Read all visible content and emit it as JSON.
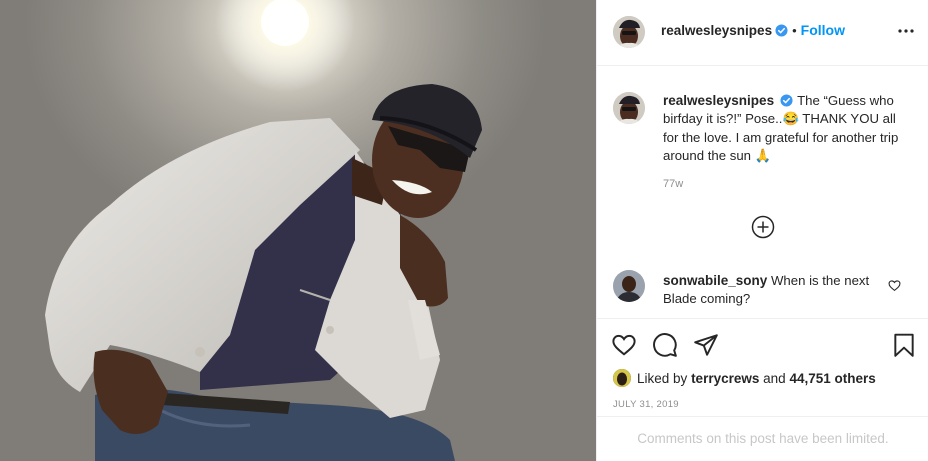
{
  "post": {
    "image_alt": "Photo of a man in a white blazer and flat cap smiling",
    "author": "realwesleysnipes",
    "follow_label": "Follow",
    "separator": "•",
    "caption": {
      "username": "realwesleysnipes",
      "text": "The “Guess who birfday it is?!” Pose..😂 THANK YOU all for the love. I am grateful for another trip around the sun 🙏",
      "time_ago": "77w"
    },
    "comment": {
      "username": "sonwabile_sony",
      "text": "When is the next Blade coming?"
    },
    "likes": {
      "prefix": "Liked by",
      "user": "terrycrews",
      "conjunction": "and",
      "count": "44,751 others"
    },
    "date": "JULY 31, 2019",
    "comments_limited": "Comments on this post have been limited."
  },
  "colors": {
    "accent": "#0095f6",
    "text": "#262626",
    "muted": "#8e8e8e",
    "limited": "#c7c7c7",
    "border": "#efefef"
  },
  "icons": {
    "verified": "verified-badge-icon",
    "more": "more-options-icon",
    "load_more": "plus-circle-icon",
    "comment_like": "heart-outline-icon",
    "like": "heart-outline-icon",
    "comment": "comment-bubble-icon",
    "share": "paper-plane-icon",
    "save": "bookmark-icon"
  }
}
